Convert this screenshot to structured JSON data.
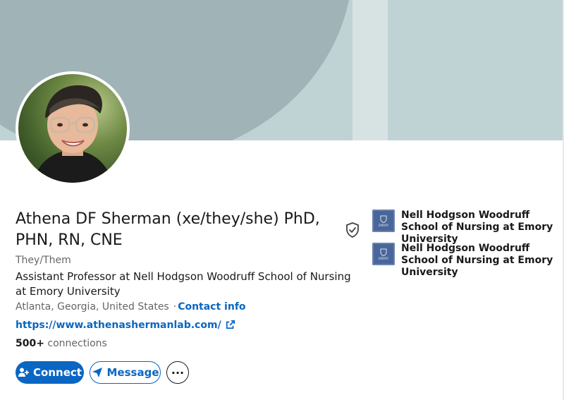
{
  "profile": {
    "name": "Athena DF Sherman (xe/they/she) PhD, PHN, RN, CNE",
    "pronouns": "They/Them",
    "headline": "Assistant Professor at Nell Hodgson Woodruff School of Nursing at Emory University",
    "location": "Atlanta, Georgia, United States",
    "separator": "·",
    "contact_info": "Contact info",
    "website": "https://www.athenashermanlab.com/",
    "connections_count": "500+",
    "connections_label": "connections"
  },
  "actions": {
    "connect_label": "Connect",
    "message_label": "Message",
    "more_label": "···"
  },
  "organizations": [
    {
      "name": "Nell Hodgson Woodruff School of Nursing at Emory University",
      "logo_text": "EMORY"
    },
    {
      "name": "Nell Hodgson Woodruff School of Nursing at Emory University",
      "logo_text": "EMORY"
    }
  ],
  "icons": {
    "verified": "verified-shield-icon",
    "external_link": "external-link-icon",
    "connect": "add-person-icon",
    "message": "send-icon"
  },
  "colors": {
    "accent": "#0a66c2",
    "banner": "#bfd3d4",
    "text_secondary": "#666666"
  }
}
